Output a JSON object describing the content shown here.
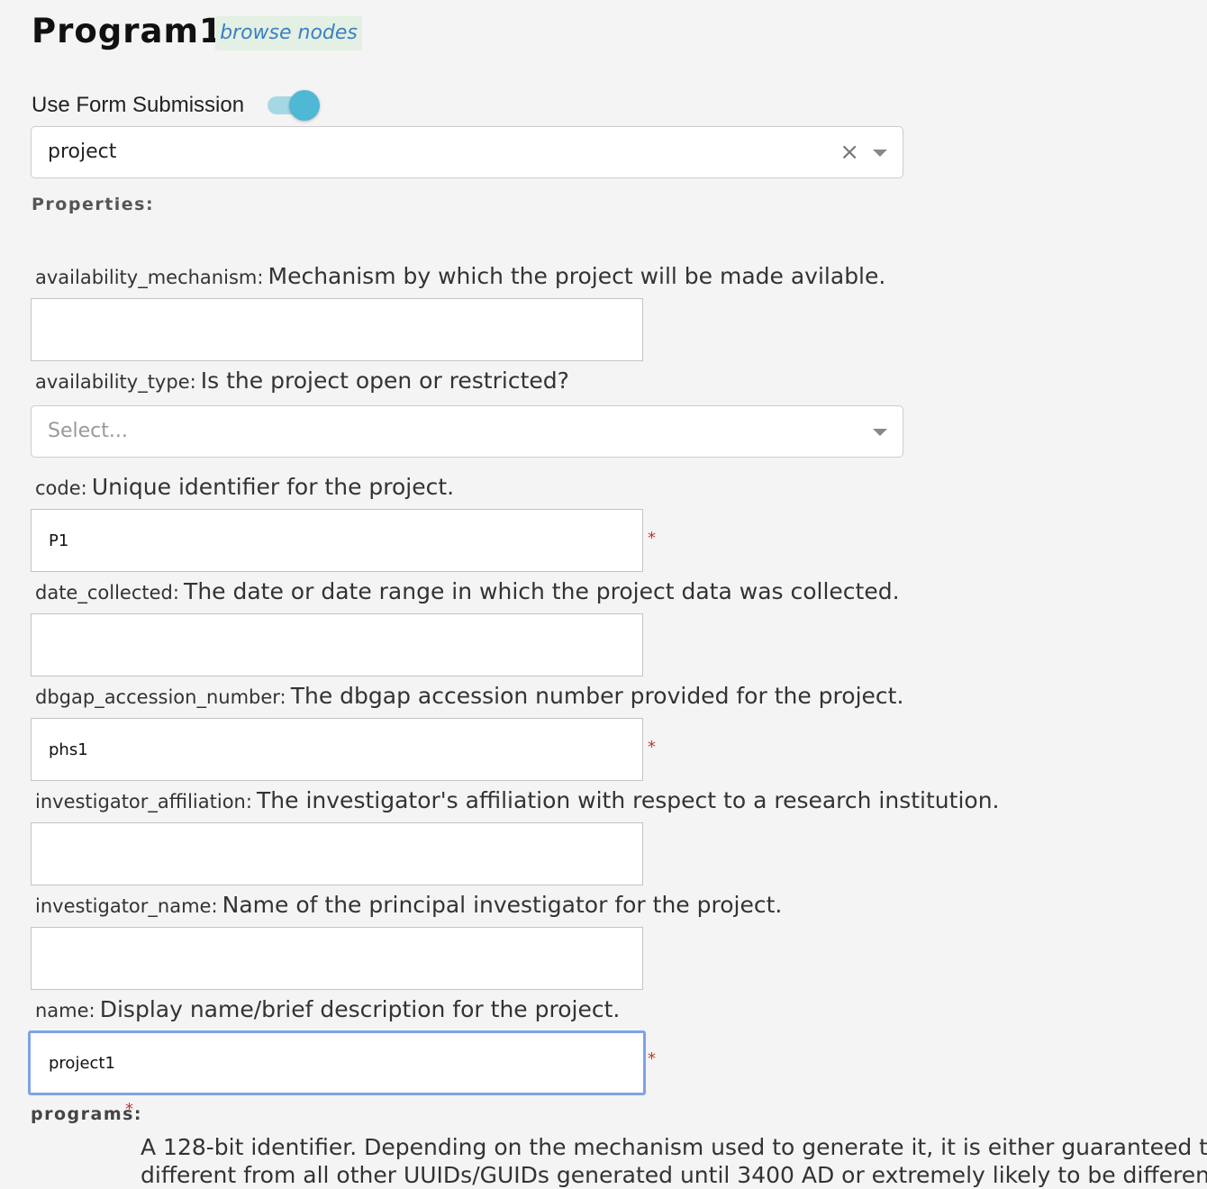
{
  "header": {
    "title": "Program1",
    "browse_link": "browse nodes"
  },
  "form_toggle": {
    "label": "Use Form Submission",
    "enabled": true
  },
  "node_select": {
    "value": "project",
    "clear_glyph": "×"
  },
  "properties_label": "Properties:",
  "fields": {
    "availability_mechanism": {
      "key": "availability_mechanism:",
      "description": "Mechanism by which the project will be made avilable.",
      "value": ""
    },
    "availability_type": {
      "key": "availability_type:",
      "description": "Is the project open or restricted?",
      "placeholder": "Select..."
    },
    "code": {
      "key": "code:",
      "description": "Unique identifier for the project.",
      "value": "P1"
    },
    "date_collected": {
      "key": "date_collected:",
      "description": "The date or date range in which the project data was collected.",
      "value": ""
    },
    "dbgap_accession_number": {
      "key": "dbgap_accession_number:",
      "description": "The dbgap accession number provided for the project.",
      "value": "phs1"
    },
    "investigator_affiliation": {
      "key": "investigator_affiliation:",
      "description": "The investigator's affiliation with respect to a research institution.",
      "value": ""
    },
    "investigator_name": {
      "key": "investigator_name:",
      "description": "Name of the principal investigator for the project.",
      "value": ""
    },
    "name": {
      "key": "name:",
      "description": "Display name/brief description for the project.",
      "value": "project1"
    }
  },
  "required_marker": "*",
  "programs": {
    "label": "programs:",
    "description_line1": "A 128-bit identifier. Depending on the mechanism used to generate it, it is either guaranteed to be",
    "description_line2": "different from all other UUIDs/GUIDs generated until 3400 AD or extremely likely to be different. Its"
  },
  "colors": {
    "background": "#f4f4f4",
    "link": "#3b7fc4",
    "link_background": "#e3f0e3",
    "toggle_on": "#4fb8d4",
    "required": "#c0392b",
    "focus_border": "#7da3e4"
  }
}
